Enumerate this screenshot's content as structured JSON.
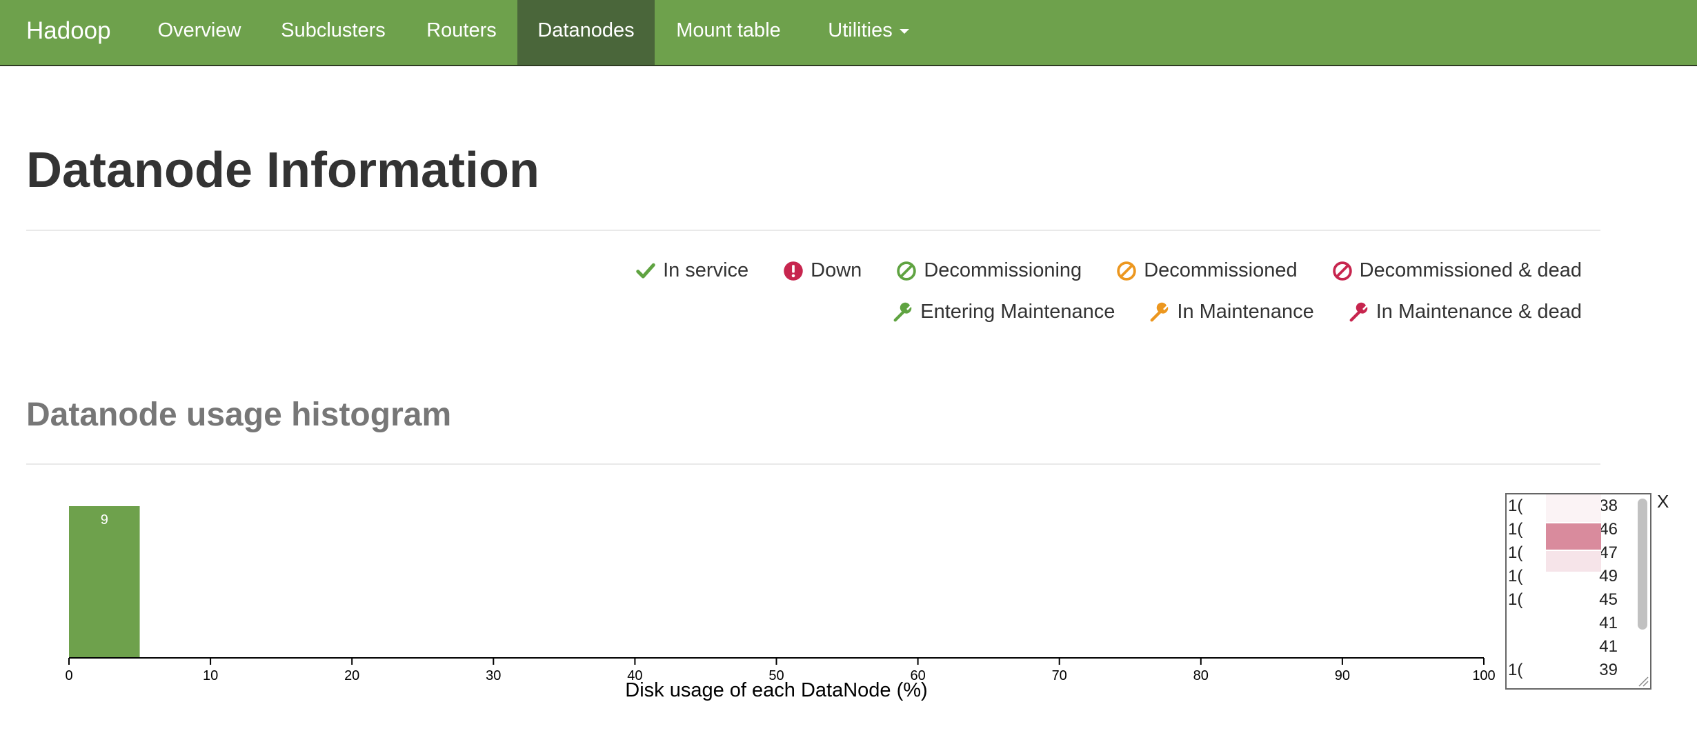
{
  "navbar": {
    "brand": "Hadoop",
    "items": [
      {
        "label": "Overview"
      },
      {
        "label": "Subclusters"
      },
      {
        "label": "Routers"
      },
      {
        "label": "Datanodes",
        "active": true
      },
      {
        "label": "Mount table"
      },
      {
        "label": "Utilities",
        "dropdown": true
      }
    ]
  },
  "page_title": "Datanode Information",
  "legend": {
    "row1": [
      {
        "label": "In service",
        "icon": "checkmark-icon",
        "color": "#5fa341"
      },
      {
        "label": "Down",
        "icon": "exclamation-circle-icon",
        "color": "#c7254e"
      },
      {
        "label": "Decommissioning",
        "icon": "ban-icon",
        "color": "#5fa341"
      },
      {
        "label": "Decommissioned",
        "icon": "ban-icon",
        "color": "#ec971f"
      },
      {
        "label": "Decommissioned & dead",
        "icon": "ban-icon",
        "color": "#c7254e"
      }
    ],
    "row2": [
      {
        "label": "Entering Maintenance",
        "icon": "wrench-icon",
        "color": "#5fa341"
      },
      {
        "label": "In Maintenance",
        "icon": "wrench-icon",
        "color": "#ec971f"
      },
      {
        "label": "In Maintenance & dead",
        "icon": "wrench-icon",
        "color": "#c7254e"
      }
    ]
  },
  "histogram_title": "Datanode usage histogram",
  "chart_data": {
    "type": "bar",
    "bins": [
      {
        "x0": 0,
        "x1": 5,
        "count": 9
      }
    ],
    "xlabel": "Disk usage of each DataNode (%)",
    "xlim": [
      0,
      100
    ],
    "xticks": [
      "0",
      "10",
      "20",
      "30",
      "40",
      "50",
      "60",
      "70",
      "80",
      "90",
      "100"
    ],
    "bar_color": "#6ea14c"
  },
  "popup": {
    "rows": [
      {
        "left": "1(",
        "right": "38"
      },
      {
        "left": "1(",
        "right": "46"
      },
      {
        "left": "1(",
        "right": "47"
      },
      {
        "left": "1(",
        "right": "49"
      },
      {
        "left": "1(",
        "right": "45"
      },
      {
        "left": "",
        "right": "41"
      },
      {
        "left": "",
        "right": "41"
      },
      {
        "left": "1(",
        "right": "39"
      }
    ],
    "close_label": "X"
  }
}
